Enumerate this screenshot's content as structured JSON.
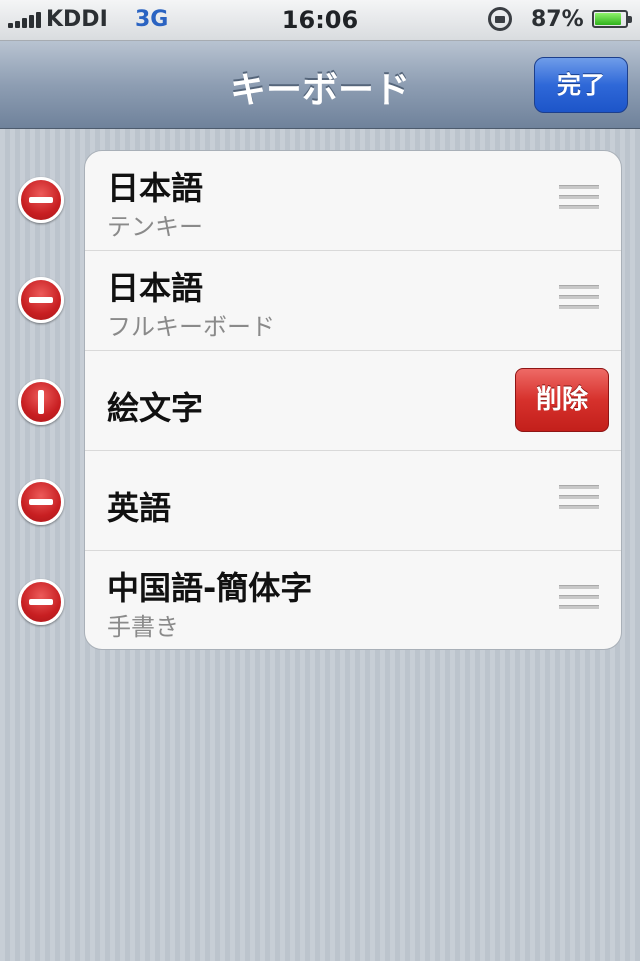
{
  "status_bar": {
    "carrier": "KDDI",
    "network": "3G",
    "time": "16:06",
    "battery_percent": "87%",
    "battery_level": 0.87,
    "icons": {
      "signal": "signal-bars-icon",
      "lock": "rotation-lock-icon",
      "battery": "battery-icon"
    }
  },
  "nav_bar": {
    "title": "キーボード",
    "done_label": "完了"
  },
  "keyboards": [
    {
      "title": "日本語",
      "subtitle": "テンキー"
    },
    {
      "title": "日本語",
      "subtitle": "フルキーボード"
    },
    {
      "title": "絵文字",
      "subtitle": "",
      "delete_label": "削除"
    },
    {
      "title": "英語",
      "subtitle": ""
    },
    {
      "title": "中国語-簡体字",
      "subtitle": "手書き"
    }
  ],
  "colors": {
    "delete_red": "#d6312c",
    "done_blue": "#2f68d8",
    "nav_bar": "#8e9eb3"
  }
}
